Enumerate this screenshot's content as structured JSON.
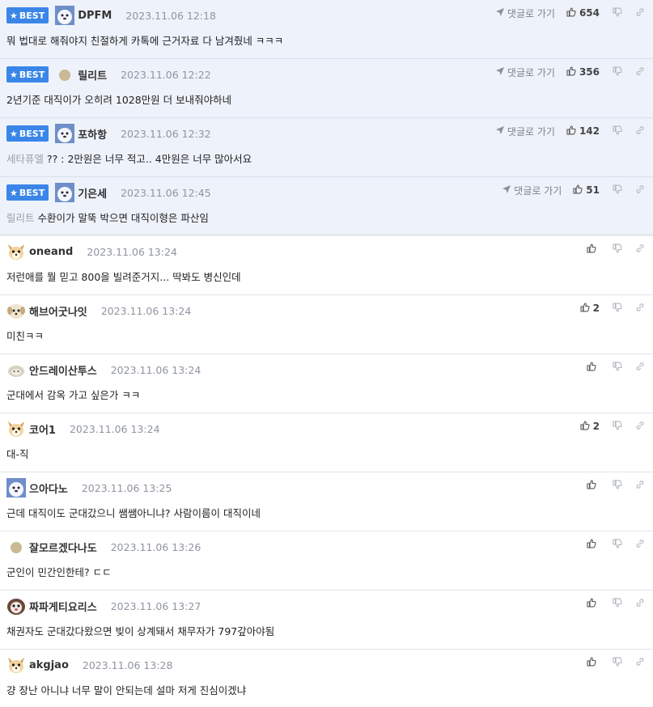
{
  "labels": {
    "best": "BEST",
    "goto_reply": "댓글로 가기"
  },
  "colors": {
    "best_badge": "#3a86e8",
    "best_row_bg": "#eef2fa",
    "timestamp": "#8f95a0"
  },
  "comments": [
    {
      "best": true,
      "avatar": "dog-avatar-icon",
      "nickname": "DPFM",
      "time": "2023.11.06 12:18",
      "ref": "",
      "text": "뭐 법대로 해줘야지 친절하게 카톡에 근거자료 다 남겨줬네 ㅋㅋㅋ",
      "likes": "654"
    },
    {
      "best": true,
      "avatar": "dot-avatar-icon",
      "nickname": "릴리트",
      "time": "2023.11.06 12:22",
      "ref": "",
      "text": "2년기준 대직이가 오히려 1028만원 더 보내줘야하네",
      "likes": "356"
    },
    {
      "best": true,
      "avatar": "dog-avatar-icon",
      "nickname": "포하항",
      "time": "2023.11.06 12:32",
      "ref": "세타퓨엘",
      "text": "?? : 2만원은 너무 적고.. 4만원은 너무 많아서요",
      "likes": "142"
    },
    {
      "best": true,
      "avatar": "dog-avatar-icon",
      "nickname": "기은세",
      "time": "2023.11.06 12:45",
      "ref": "릴리트",
      "text": "수환이가 말뚝 박으면 대직이형은 파산임",
      "likes": "51"
    },
    {
      "best": false,
      "avatar": "fox-avatar-icon",
      "nickname": "oneand",
      "time": "2023.11.06 13:24",
      "ref": "",
      "text": "저런애를 뭘 믿고 800을 빌려준거지... 딱봐도 병신인데",
      "likes": ""
    },
    {
      "best": false,
      "avatar": "puppy-avatar-icon",
      "nickname": "해브어굿나잇",
      "time": "2023.11.06 13:24",
      "ref": "",
      "text": "미친ㅋㅋ",
      "likes": "2"
    },
    {
      "best": false,
      "avatar": "lamb-avatar-icon",
      "nickname": "안드레이산투스",
      "time": "2023.11.06 13:24",
      "ref": "",
      "text": "군대에서 감옥 가고 싶은가 ㅋㅋ",
      "likes": ""
    },
    {
      "best": false,
      "avatar": "fox-avatar-icon",
      "nickname": "코어1",
      "time": "2023.11.06 13:24",
      "ref": "",
      "text": "대-직",
      "likes": "2"
    },
    {
      "best": false,
      "avatar": "dog-avatar-icon",
      "nickname": "으아다노",
      "time": "2023.11.06 13:25",
      "ref": "",
      "text": "근데 대직이도 군대갔으니 쌤쌤아니냐? 사람이름이 대직이네",
      "likes": ""
    },
    {
      "best": false,
      "avatar": "dot-avatar-icon",
      "nickname": "잘모르겠다나도",
      "time": "2023.11.06 13:26",
      "ref": "",
      "text": "군인이 민간인한테? ㄷㄷ",
      "likes": ""
    },
    {
      "best": false,
      "avatar": "shih-tzu-avatar-icon",
      "nickname": "짜파게티요리스",
      "time": "2023.11.06 13:27",
      "ref": "",
      "text": "채권자도 군대갔다왔으면 빚이 상계돼서 채무자가 797갚아야됨",
      "likes": ""
    },
    {
      "best": false,
      "avatar": "fox-avatar-icon",
      "nickname": "akgjao",
      "time": "2023.11.06 13:28",
      "ref": "",
      "text": "걍 장난 아니냐 너무 말이 안되는데 설마 저게 진심이겠냐",
      "likes": ""
    }
  ]
}
